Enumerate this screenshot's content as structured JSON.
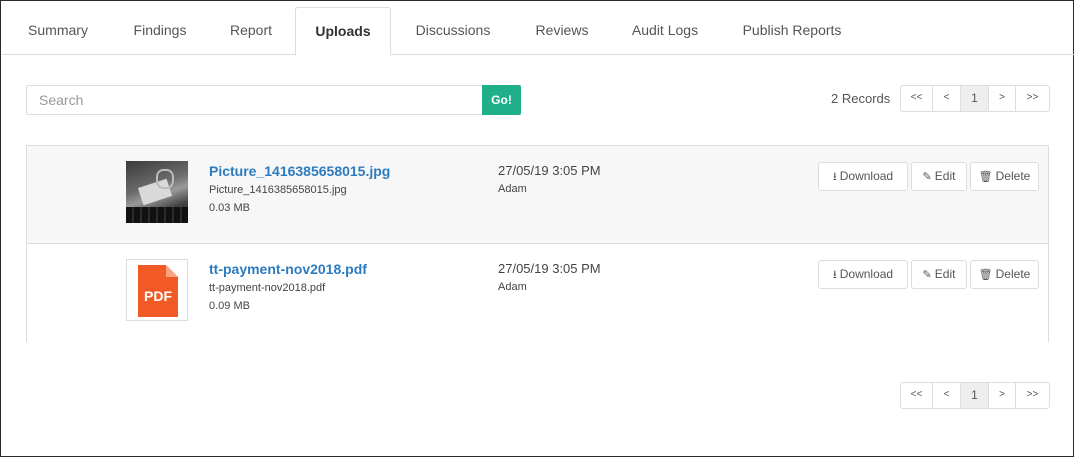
{
  "tabs": [
    {
      "label": "Summary"
    },
    {
      "label": "Findings"
    },
    {
      "label": "Report"
    },
    {
      "label": "Uploads",
      "active": true
    },
    {
      "label": "Discussions"
    },
    {
      "label": "Reviews"
    },
    {
      "label": "Audit Logs"
    },
    {
      "label": "Publish Reports"
    }
  ],
  "search": {
    "placeholder": "Search",
    "go_label": "Go!"
  },
  "records_label": "2 Records",
  "pagination": {
    "first": "<<",
    "prev": "<",
    "page": "1",
    "next": ">",
    "last": ">>"
  },
  "files": [
    {
      "title": "Picture_1416385658015.jpg",
      "filename": "Picture_1416385658015.jpg",
      "size": "0.03 MB",
      "date": "27/05/19 3:05 PM",
      "user": "Adam",
      "thumb": "photo"
    },
    {
      "title": "tt-payment-nov2018.pdf",
      "filename": "tt-payment-nov2018.pdf",
      "size": "0.09 MB",
      "date": "27/05/19 3:05 PM",
      "user": "Adam",
      "thumb": "pdf",
      "thumb_label": "PDF"
    }
  ],
  "actions": {
    "download": "Download",
    "edit": "Edit",
    "delete": "Delete"
  },
  "icons": {
    "download": "download-icon",
    "edit": "pencil-icon",
    "delete": "trash-icon",
    "pdf": "pdf-file-icon"
  },
  "colors": {
    "accent": "#1fb08a",
    "link": "#2d7bbf",
    "pdf": "#f15a24"
  }
}
